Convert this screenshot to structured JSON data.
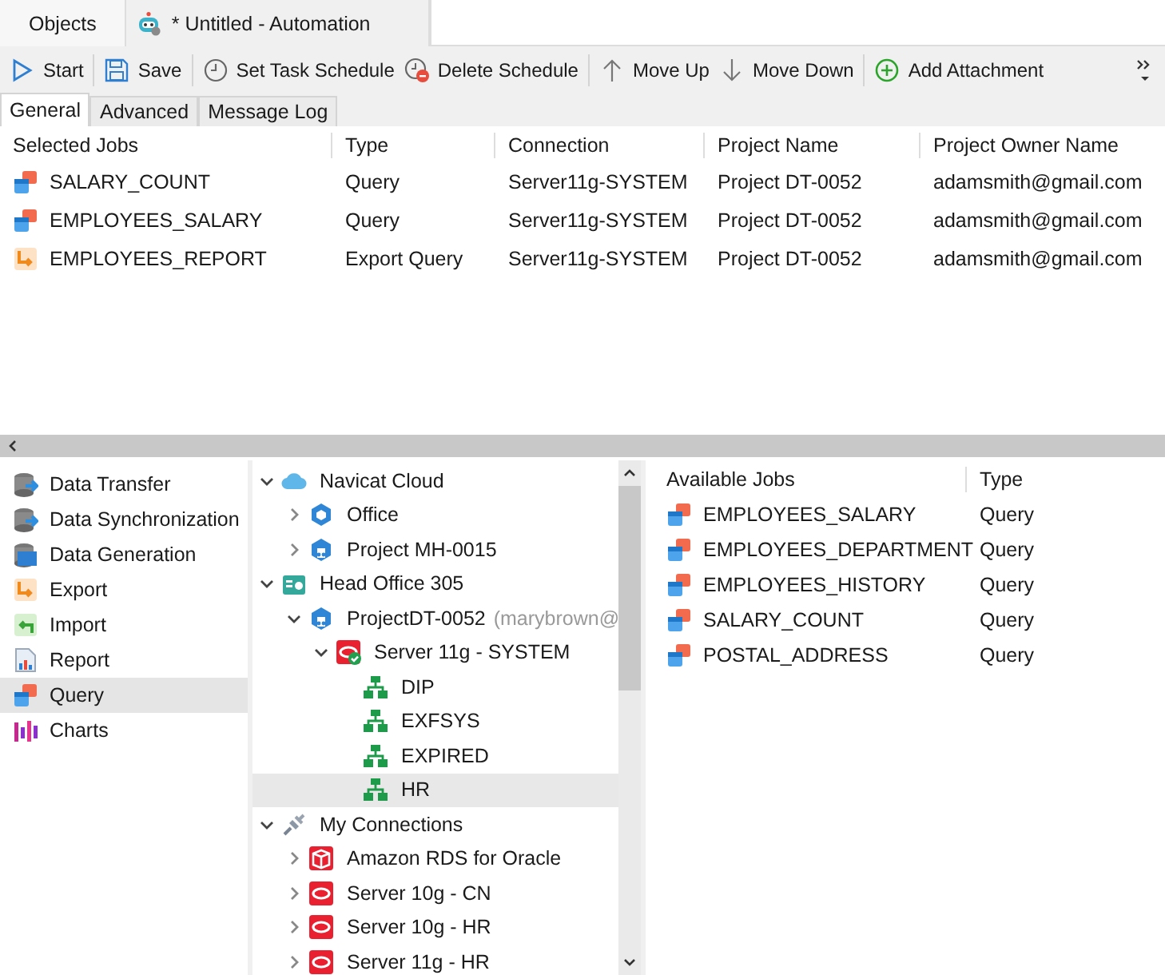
{
  "doc_tabs": [
    {
      "label": "Objects",
      "kind": "plain",
      "selected": false
    },
    {
      "label": "* Untitled - Automation",
      "kind": "robot",
      "selected": true
    }
  ],
  "toolbar_groups": [
    [
      {
        "label": "Start",
        "kind": "play"
      }
    ],
    [
      {
        "label": "Save",
        "kind": "save"
      }
    ],
    [
      {
        "label": "Set Task Schedule",
        "kind": "clock"
      },
      {
        "label": "Delete Schedule",
        "kind": "clock-delete"
      }
    ],
    [
      {
        "label": "Move Up",
        "kind": "up"
      },
      {
        "label": "Move Down",
        "kind": "down"
      }
    ],
    [
      {
        "label": "Add Attachment",
        "kind": "add"
      }
    ]
  ],
  "sub_tabs": [
    {
      "label": "General",
      "selected": true
    },
    {
      "label": "Advanced",
      "selected": false
    },
    {
      "label": "Message Log",
      "selected": false
    }
  ],
  "jobs_table": {
    "columns": [
      "Selected Jobs",
      "Type",
      "Connection",
      "Project Name",
      "Project Owner Name"
    ],
    "rows": [
      {
        "kind": "query",
        "cells": [
          "SALARY_COUNT",
          "Query",
          "Server11g-SYSTEM",
          "Project DT-0052",
          "adamsmith@gmail.com"
        ]
      },
      {
        "kind": "query",
        "cells": [
          "EMPLOYEES_SALARY",
          "Query",
          "Server11g-SYSTEM",
          "Project DT-0052",
          "adamsmith@gmail.com"
        ]
      },
      {
        "kind": "export",
        "cells": [
          "EMPLOYEES_REPORT",
          "Export Query",
          "Server11g-SYSTEM",
          "Project DT-0052",
          "adamsmith@gmail.com"
        ]
      }
    ]
  },
  "categories": [
    {
      "label": "Data Transfer",
      "kind": "transfer",
      "selected": false
    },
    {
      "label": "Data Synchronization",
      "kind": "sync",
      "selected": false
    },
    {
      "label": "Data Generation",
      "kind": "generation",
      "selected": false
    },
    {
      "label": "Export",
      "kind": "export",
      "selected": false
    },
    {
      "label": "Import",
      "kind": "import",
      "selected": false
    },
    {
      "label": "Report",
      "kind": "report",
      "selected": false
    },
    {
      "label": "Query",
      "kind": "query",
      "selected": true
    },
    {
      "label": "Charts",
      "kind": "charts",
      "selected": false
    }
  ],
  "tree": [
    {
      "label": "Navicat Cloud",
      "kind": "cloud",
      "expanded": true,
      "selected": false,
      "children": [
        {
          "label": "Office",
          "kind": "hexagon",
          "expanded": false,
          "selected": false
        },
        {
          "label": "Project MH-0015",
          "kind": "project",
          "expanded": false,
          "selected": false
        }
      ]
    },
    {
      "label": "Head Office 305",
      "kind": "office",
      "expanded": true,
      "selected": false,
      "children": [
        {
          "label": "ProjectDT-0052",
          "owner": "(marybrown@",
          "kind": "project",
          "expanded": true,
          "selected": false,
          "children": [
            {
              "label": "Server 11g - SYSTEM",
              "kind": "server-connected",
              "expanded": true,
              "selected": false,
              "children": [
                {
                  "label": "DIP",
                  "kind": "schema",
                  "selected": false
                },
                {
                  "label": "EXFSYS",
                  "kind": "schema",
                  "selected": false
                },
                {
                  "label": "EXPIRED",
                  "kind": "schema",
                  "selected": false
                },
                {
                  "label": "HR",
                  "kind": "schema",
                  "selected": true
                }
              ]
            }
          ]
        }
      ]
    },
    {
      "label": "My Connections",
      "kind": "connections",
      "expanded": true,
      "selected": false,
      "children": [
        {
          "label": "Amazon RDS for Oracle",
          "kind": "amazon",
          "expanded": false,
          "selected": false
        },
        {
          "label": "Server 10g - CN",
          "kind": "server",
          "expanded": false,
          "selected": false
        },
        {
          "label": "Server 10g - HR",
          "kind": "server",
          "expanded": false,
          "selected": false
        },
        {
          "label": "Server 11g - HR",
          "kind": "server",
          "expanded": false,
          "selected": false
        }
      ]
    }
  ],
  "available_table": {
    "columns": [
      "Available Jobs",
      "Type"
    ],
    "rows": [
      {
        "kind": "query",
        "cells": [
          "EMPLOYEES_SALARY",
          "Query"
        ]
      },
      {
        "kind": "query",
        "cells": [
          "EMPLOYEES_DEPARTMENT",
          "Query"
        ]
      },
      {
        "kind": "query",
        "cells": [
          "EMPLOYEES_HISTORY",
          "Query"
        ]
      },
      {
        "kind": "query",
        "cells": [
          "SALARY_COUNT",
          "Query"
        ]
      },
      {
        "kind": "query",
        "cells": [
          "POSTAL_ADDRESS",
          "Query"
        ]
      }
    ]
  }
}
